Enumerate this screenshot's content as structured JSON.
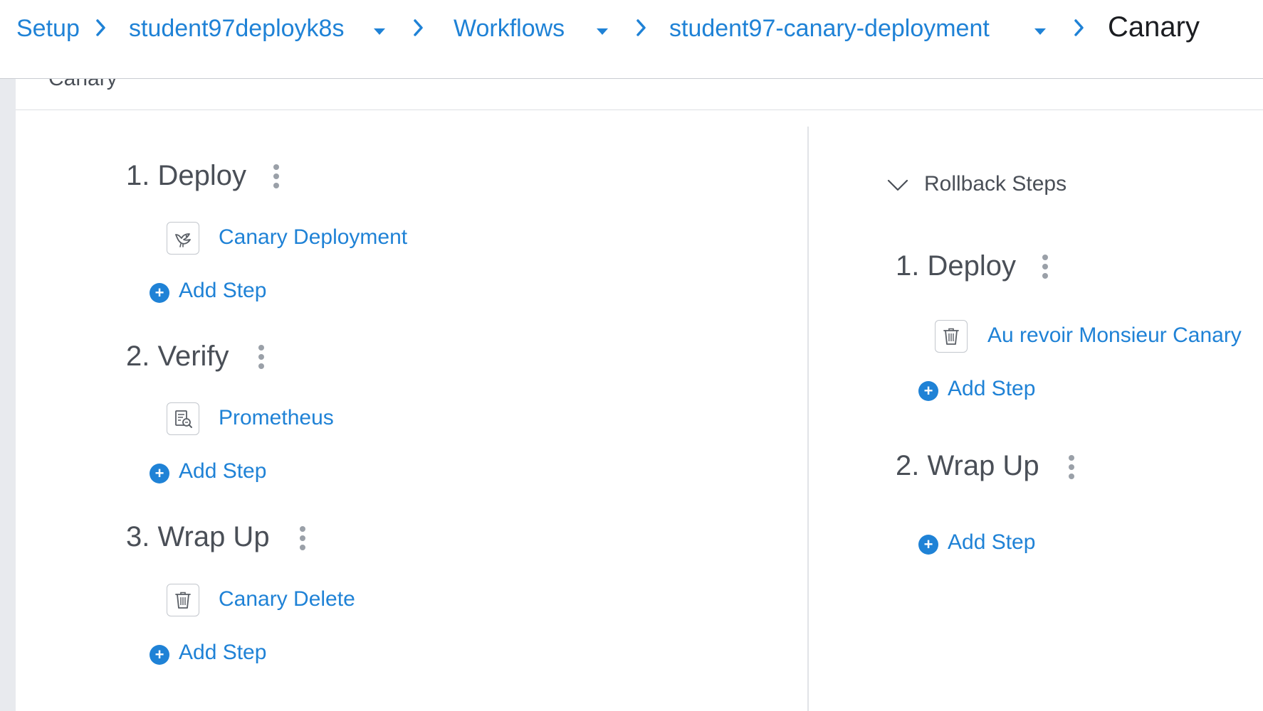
{
  "breadcrumb": {
    "items": [
      {
        "label": "Setup"
      },
      {
        "label": "student97deployk8s"
      },
      {
        "label": "Workflows"
      },
      {
        "label": "student97-canary-deployment"
      },
      {
        "label": "Canary"
      }
    ]
  },
  "subheader": {
    "label": "Canary"
  },
  "deployment_steps": {
    "sections": [
      {
        "title": "1. Deploy",
        "steps": [
          {
            "label": "Canary Deployment",
            "icon": "canary-bird-icon"
          }
        ],
        "add_label": "Add Step"
      },
      {
        "title": "2. Verify",
        "steps": [
          {
            "label": "Prometheus",
            "icon": "report-search-icon"
          }
        ],
        "add_label": "Add Step"
      },
      {
        "title": "3. Wrap Up",
        "steps": [
          {
            "label": "Canary Delete",
            "icon": "trash-icon"
          }
        ],
        "add_label": "Add Step"
      }
    ]
  },
  "rollback": {
    "header": "Rollback Steps",
    "sections": [
      {
        "title": "1. Deploy",
        "steps": [
          {
            "label": "Au revoir Monsieur Canary",
            "icon": "trash-icon"
          }
        ],
        "add_label": "Add Step"
      },
      {
        "title": "2. Wrap Up",
        "steps": [],
        "add_label": "Add Step"
      }
    ]
  },
  "colors": {
    "link": "#1f82d6",
    "text": "#4a4f57",
    "current": "#1b1d21",
    "rail": "#e8eaee"
  }
}
